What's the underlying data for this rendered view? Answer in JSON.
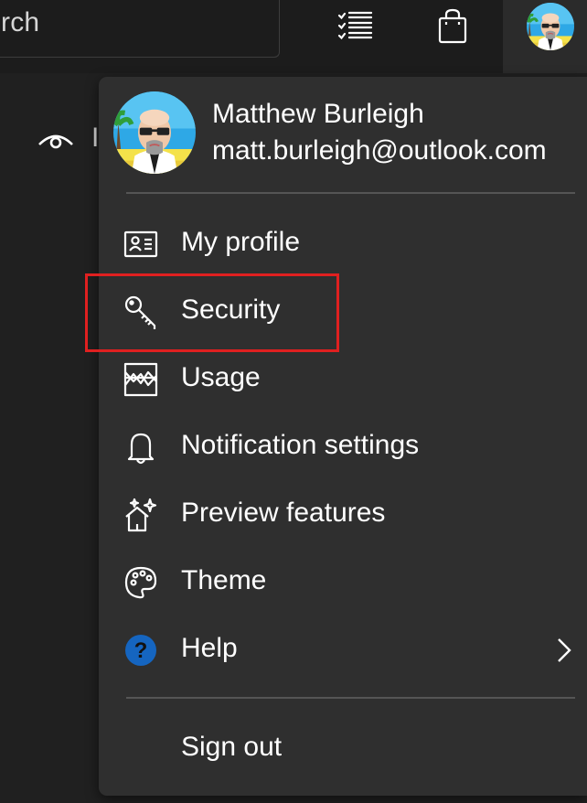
{
  "topbar": {
    "search_text": "rch",
    "icons": [
      "task-list-icon",
      "shopping-bag-icon"
    ],
    "avatar": "profile-avatar"
  },
  "background": {
    "partial_text": "I"
  },
  "account_menu": {
    "user_name": "Matthew Burleigh",
    "user_email": "matt.burleigh@outlook.com",
    "items": [
      {
        "label": "My profile",
        "icon": "contact-card-icon"
      },
      {
        "label": "Security",
        "icon": "key-icon"
      },
      {
        "label": "Usage",
        "icon": "usage-chart-icon"
      },
      {
        "label": "Notification settings",
        "icon": "bell-icon"
      },
      {
        "label": "Preview features",
        "icon": "sparkle-house-icon"
      },
      {
        "label": "Theme",
        "icon": "palette-icon"
      },
      {
        "label": "Help",
        "icon": "help-icon"
      }
    ],
    "sign_out_label": "Sign out"
  },
  "colors": {
    "menu_background": "#2f2f2f",
    "page_background": "#202020",
    "highlight_border": "#e02020",
    "help_icon_blue": "#1565c0"
  }
}
